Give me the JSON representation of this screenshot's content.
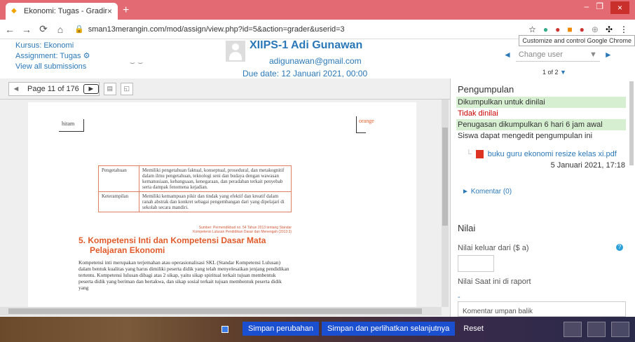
{
  "browser": {
    "tab_title": "Ekonomi: Tugas - Grading",
    "url": "sman13merangin.com/mod/assign/view.php?id=5&action=grader&userid=3",
    "tooltip": "Customize and control Google Chrome"
  },
  "header": {
    "course_link": "Kursus: Ekonomi",
    "assignment_link": "Assignment: Tugas",
    "view_all": "View all submissions",
    "student_name": "XIIPS-1 Adi Gunawan",
    "student_email": "adigunawan@gmail.com",
    "due_date": "Due date: 12 Januari 2021, 00:00",
    "change_user_placeholder": "Change user",
    "user_count": "1 of 2"
  },
  "viewer": {
    "page_label": "Page 11 of 176",
    "left_label": "hitam",
    "right_label": "orange",
    "table": [
      {
        "col1": "Pengetahuan",
        "col2": "Memiliki pengetahuan faktual, konseptual, prosedural, dan metakognitif dalam ilmu pengetahuan, teknologi seni dan budaya dengan wawasan kemanusiaan, kebangsaan, kenegaraan, dan peradaban terkait penyebab serta dampak fenomena kejadian."
      },
      {
        "col1": "Keterampilan",
        "col2": "Memiliki kemampuan pikir dan tindak yang efektif dan kreatif dalam ranah abstrak dan konkret sebagai pengembangan dari yang dipelajari di sekolah secara mandiri."
      }
    ],
    "source": "Sumber: Permendikbud no. 54 Tahun 2013 tentang Standar Kompetensi Lulusan Pendidikan Dasar dan Menengah (2013:3)",
    "section_title_1": "5. Kompetensi Inti dan Kompetensi Dasar Mata",
    "section_title_2": "Pelajaran Ekonomi",
    "section_body": "Kompetensi inti merupakan terjemahan atau operasionalisasi SKL (Standar Kompetensi Lulusan) dalam bentuk kualitas yang harus dimiliki peserta didik yang telah menyelesaikan jenjang pendidikan tertentu. Kompetensi lulusan dibagi atas 2 sikap, yaitu sikap spiritual terkait tujuan membentuk peserta didik yang beriman dan bertakwa, dan sikap sosial terkait tujuan membentuk peserta didik yang"
  },
  "panel": {
    "title": "Pengumpulan",
    "status_submitted": "Dikumpulkan untuk dinilai",
    "status_graded": "Tidak dinilai",
    "status_early": "Penugasan dikumpulkan 6 hari 6 jam awal",
    "status_edit": "Siswa dapat mengedit pengumpulan ini",
    "file_name": "buku guru ekonomi resize kelas xi.pdf",
    "file_date": "5 Januari 2021, 17:18",
    "comments": "Komentar (0)",
    "grade_heading": "Nilai",
    "grade_label": "Nilai keluar dari ($ a)",
    "raport_label": "Nilai Saat ini di raport",
    "dash": "-",
    "feedback_label": "Komentar umpan balik"
  },
  "footer": {
    "save": "Simpan perubahan",
    "save_next": "Simpan dan perlihatkan selanjutnya",
    "reset": "Reset"
  }
}
